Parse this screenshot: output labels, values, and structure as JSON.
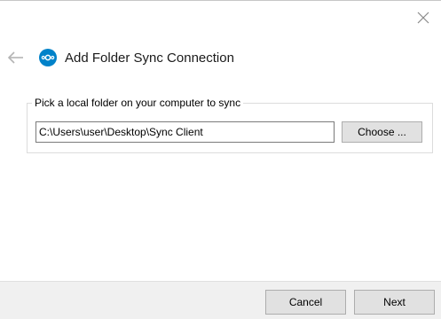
{
  "window": {
    "title": "Add Folder Sync Connection"
  },
  "header": {
    "back_icon": "arrow-left-icon",
    "logo_icon": "nextcloud-logo-icon",
    "close_icon": "close-icon"
  },
  "folder_group": {
    "legend": "Pick a local folder on your computer to sync",
    "path_value": "C:\\Users\\user\\Desktop\\Sync Client",
    "choose_label": "Choose ..."
  },
  "footer": {
    "cancel_label": "Cancel",
    "next_label": "Next"
  },
  "colors": {
    "brand": "#0082c9",
    "button_face": "#e1e1e1",
    "footer_background": "#f0f0f0"
  }
}
